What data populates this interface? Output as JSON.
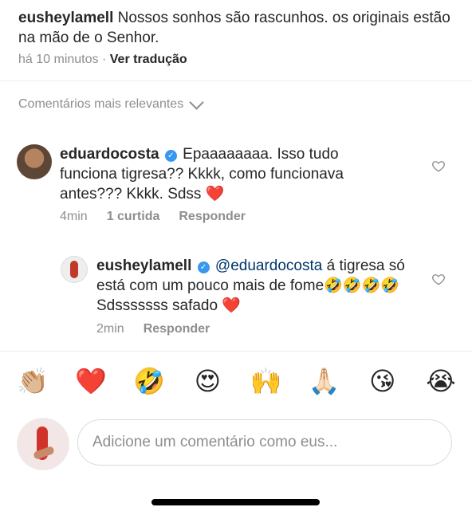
{
  "caption": {
    "username": "eusheylamell",
    "text": "Nossos sonhos são rascunhos. os originais estão na mão de o Senhor.",
    "time": "há 10 minutos",
    "separator": "·",
    "translate": "Ver tradução"
  },
  "filter": {
    "label": "Comentários mais relevantes"
  },
  "comments": [
    {
      "username": "eduardocosta",
      "verified": true,
      "text": "Epaaaaaaaa. Isso tudo funciona tigresa?? Kkkk, como funcionava antes??? Kkkk. Sdss",
      "trailing_emoji": "❤️",
      "time": "4min",
      "likes": "1 curtida",
      "reply": "Responder"
    },
    {
      "username": "eusheylamell",
      "verified": true,
      "mention": "@eduardocosta",
      "text": " á tigresa só está com um pouco mais de fome🤣🤣🤣🤣 Sdsssssss safado ",
      "trailing_emoji": "❤️",
      "time": "2min",
      "reply": "Responder"
    }
  ],
  "quick_reactions": [
    "👏🏼",
    "❤️",
    "🤣",
    "😍",
    "🙌",
    "🙏🏻",
    "😘",
    "😭"
  ],
  "composer": {
    "placeholder": "Adicione um comentário como eus..."
  }
}
